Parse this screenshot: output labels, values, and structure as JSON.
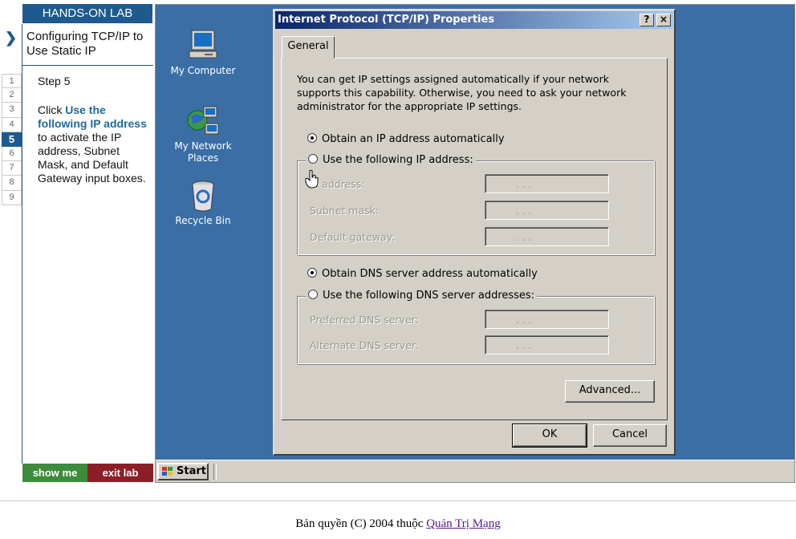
{
  "lab": {
    "header": "HANDS-ON LAB",
    "title": "Configuring TCP/IP to Use Static IP",
    "steps": [
      "1",
      "2",
      "3",
      "4",
      "5",
      "6",
      "7",
      "8",
      "9"
    ],
    "current_step": "5",
    "step_label": "Step 5",
    "instruction_prefix": "Click ",
    "instruction_highlight": "Use the following IP address",
    "instruction_suffix": " to activate the IP address, Subnet Mask, and Default Gateway input boxes.",
    "show_me": "show me",
    "exit_lab": "exit lab"
  },
  "desktop": {
    "icons": [
      {
        "label": "My Computer",
        "icon": "my-computer-icon"
      },
      {
        "label": "My Network Places",
        "icon": "network-places-icon"
      },
      {
        "label": "Recycle Bin",
        "icon": "recycle-bin-icon"
      }
    ],
    "start": "Start"
  },
  "dialog": {
    "title": "Internet Protocol (TCP/IP) Properties",
    "help": "?",
    "close": "×",
    "tab": "General",
    "description": "You can get IP settings assigned automatically if your network supports this capability. Otherwise, you need to ask your network administrator for the appropriate IP settings.",
    "ip_auto": "Obtain an IP address automatically",
    "ip_manual": "Use the following IP address:",
    "ip_auto_selected": true,
    "ip_address_label": "IP address:",
    "subnet_label": "Subnet mask:",
    "gateway_label": "Default gateway:",
    "dns_auto": "Obtain DNS server address automatically",
    "dns_manual": "Use the following DNS server addresses:",
    "dns_auto_selected": true,
    "preferred_dns_label": "Preferred DNS server:",
    "alternate_dns_label": "Alternate DNS server:",
    "ip_placeholder": ".   .   .",
    "advanced": "Advanced...",
    "ok": "OK",
    "cancel": "Cancel"
  },
  "footer": {
    "prefix": "Bản quyền (C) 2004 thuộc ",
    "link": "Quản Trị Mạng"
  },
  "colors": {
    "lab_blue": "#1e5a8e",
    "desktop_bg": "#3a6ea5",
    "window_face": "#d4d0c8",
    "titlebar_start": "#0a246a",
    "titlebar_end": "#a6caf0",
    "show_me_green": "#3c8c3c",
    "exit_red": "#8c1e28"
  }
}
